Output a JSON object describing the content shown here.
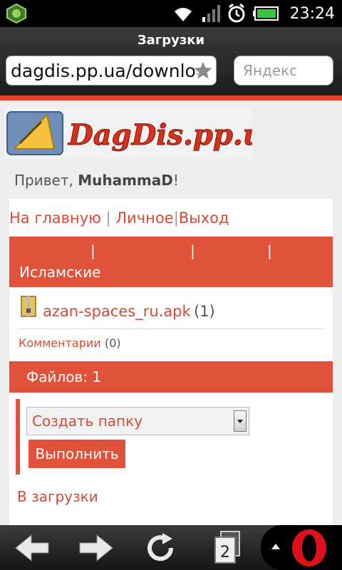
{
  "status_bar": {
    "time": "23:24"
  },
  "browser": {
    "title": "Загрузки",
    "url": "dagdis.pp.ua/download",
    "search_placeholder": "Яндекс",
    "tab_count": "2"
  },
  "page": {
    "logo_text": "DagDis.pp.ua",
    "greeting_prefix": "Привет, ",
    "username": "MuhammaD",
    "greeting_suffix": "!",
    "nav": [
      {
        "label": "На главную"
      },
      {
        "label": "Личное"
      },
      {
        "label": "Выход"
      }
    ],
    "nav_separator": "|",
    "category_separator": "|",
    "category_label": "Исламские",
    "file": {
      "name": "azan-spaces_ru.apk",
      "count": "(1)"
    },
    "comments": {
      "label": "Комментарии",
      "count": "(0)"
    },
    "files_count_label": "Файлов: 1",
    "folder_select": {
      "value": "Создать папку"
    },
    "run_button": "Выполнить",
    "back_link": "В загрузки"
  },
  "colors": {
    "accent": "#e0533a",
    "link": "#d94a33",
    "status_bg": "#000000"
  }
}
